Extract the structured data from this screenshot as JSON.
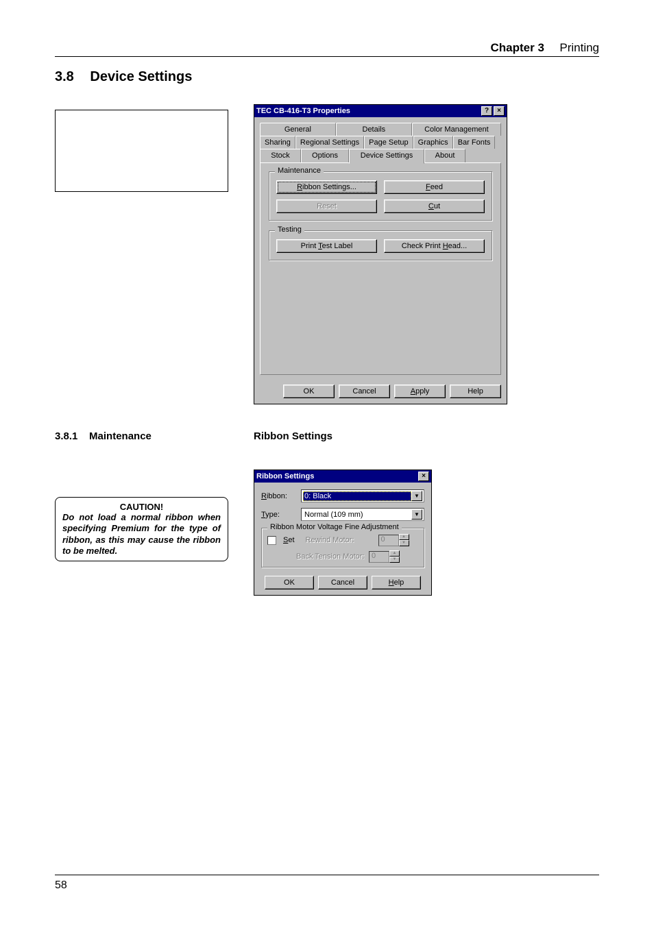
{
  "header": {
    "chapter": "Chapter 3",
    "title": "Printing"
  },
  "section": {
    "num": "3.8",
    "title": "Device Settings"
  },
  "dialog1": {
    "title": "TEC CB-416-T3 Properties",
    "help_btn": "?",
    "close_btn": "×",
    "tabs_row1": [
      "General",
      "Details",
      "Color Management"
    ],
    "tabs_row2": [
      "Sharing",
      "Regional Settings",
      "Page Setup",
      "Graphics",
      "Bar Fonts"
    ],
    "tabs_row3": [
      "Stock",
      "Options",
      "Device Settings",
      "About"
    ],
    "active_tab": "Device Settings",
    "maintenance": {
      "legend": "Maintenance",
      "ribbon": "Ribbon Settings...",
      "feed": "Feed",
      "reset": "Reset",
      "cut": "Cut"
    },
    "testing": {
      "legend": "Testing",
      "print": "Print Test Label",
      "check": "Check Print Head..."
    },
    "buttons": {
      "ok": "OK",
      "cancel": "Cancel",
      "apply": "Apply",
      "help": "Help"
    }
  },
  "subsection": {
    "num": "3.8.1",
    "left": "Maintenance",
    "right": "Ribbon Settings"
  },
  "dialog2": {
    "title": "Ribbon Settings",
    "close_btn": "×",
    "ribbon_label": "Ribbon:",
    "ribbon_value": "0: Black",
    "type_label": "Type:",
    "type_value": "Normal (109 mm)",
    "adjust_legend": "Ribbon Motor Voltage Fine Adjustment",
    "set": "Set",
    "rewind": "Rewind Motor:",
    "rewind_val": "0",
    "back": "Back Tension Motor:",
    "back_val": "0",
    "ok": "OK",
    "cancel": "Cancel",
    "help": "Help"
  },
  "caution": {
    "title": "CAUTION!",
    "text": "Do not load a normal ribbon when specifying Premium for the type of ribbon, as this may cause the ribbon to be melted."
  },
  "footer": {
    "pagenum": "58"
  }
}
